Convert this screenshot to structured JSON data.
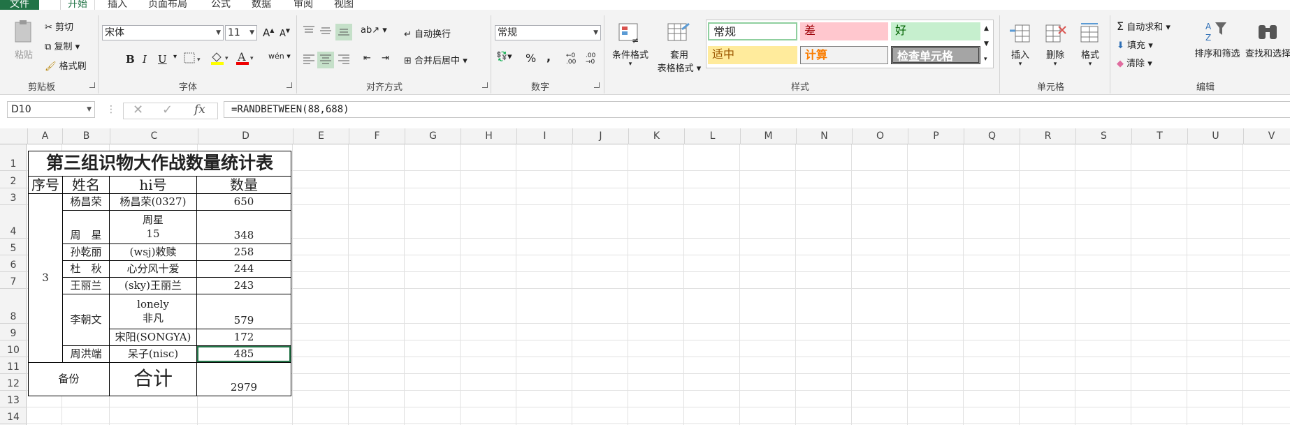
{
  "tabs": {
    "file": "文件",
    "home": "开始",
    "insert": "插入",
    "layout": "页面布局",
    "formulas": "公式",
    "data": "数据",
    "review": "审阅",
    "view": "视图"
  },
  "clipboard": {
    "paste": "粘贴",
    "cut": "剪切",
    "copy": "复制",
    "painter": "格式刷",
    "label": "剪贴板"
  },
  "font": {
    "name": "宋体",
    "size": "11",
    "label": "字体",
    "bold": "B",
    "italic": "I",
    "underline": "U"
  },
  "align": {
    "wrap": "自动换行",
    "merge": "合并后居中",
    "label": "对齐方式"
  },
  "number": {
    "format": "常规",
    "percent": "%",
    "comma": ",",
    "label": "数字"
  },
  "styles": {
    "conditional": "条件格式",
    "table_line1": "套用",
    "table_line2": "表格格式",
    "normal": "常规",
    "bad": "差",
    "good": "好",
    "neutral": "适中",
    "calc": "计算",
    "check": "检查单元格",
    "label": "样式"
  },
  "cells": {
    "insert": "插入",
    "delete": "删除",
    "format": "格式",
    "label": "单元格"
  },
  "editing": {
    "autosum": "自动求和",
    "fill": "填充",
    "clear": "清除",
    "sort": "排序和筛选",
    "find": "查找和选择",
    "label": "编辑"
  },
  "formula_bar": {
    "name_box": "D10",
    "formula": "=RANDBETWEEN(88,688)",
    "fx": "fx"
  },
  "columns": [
    "A",
    "B",
    "C",
    "D",
    "E",
    "F",
    "G",
    "H",
    "I",
    "J",
    "K",
    "L",
    "M",
    "N",
    "O",
    "P",
    "Q",
    "R",
    "S",
    "T",
    "U",
    "V"
  ],
  "rows": [
    "1",
    "2",
    "3",
    "4",
    "5",
    "6",
    "7",
    "8",
    "9",
    "10",
    "11",
    "12",
    "13",
    "14"
  ],
  "sheet": {
    "title": "第三组识物大作战数量统计表",
    "headers": [
      "序号",
      "姓名",
      "hi号",
      "数量"
    ],
    "group_no": "3",
    "names": [
      "杨昌荣",
      "周　星",
      "孙乾丽",
      "杜　秋",
      "王丽兰",
      "李朝文",
      "周洪端"
    ],
    "hi": [
      "杨昌荣(0327)",
      "周星",
      "15",
      "(wsj)敕赎",
      "心分风十爱",
      "(sky)王丽兰",
      "lonely",
      "非凡",
      "宋阳(SONGYA)",
      "呆子(nisc)"
    ],
    "qty": [
      "650",
      "348",
      "258",
      "244",
      "243",
      "579",
      "172",
      "485"
    ],
    "backup": "备份",
    "total_label": "合计",
    "total": "2979"
  },
  "colors": {
    "accent": "#217346",
    "bad_bg": "#ffc7ce",
    "bad_fg": "#9c0006",
    "good_bg": "#c6efce",
    "good_fg": "#006100",
    "neutral_bg": "#ffeb9c",
    "neutral_fg": "#9c5700",
    "calc_bg": "#f2f2f2",
    "calc_fg": "#fa7d00",
    "check_bg": "#a5a5a5"
  }
}
